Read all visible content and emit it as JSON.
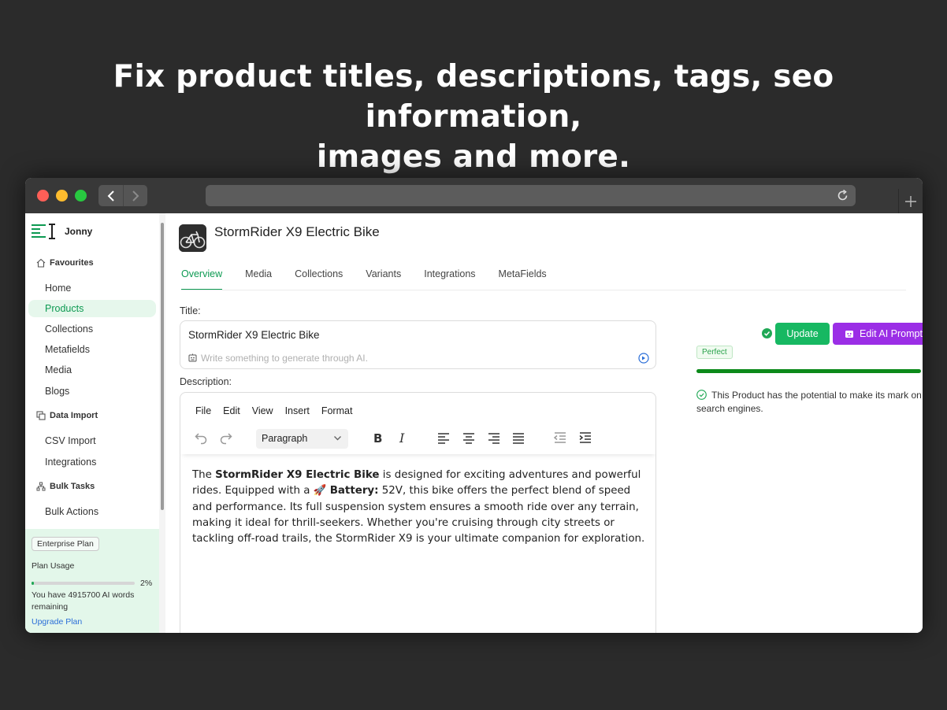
{
  "headline": {
    "line1": "Fix product titles, descriptions, tags, seo information,",
    "line2": "images and more."
  },
  "browser": {
    "url": ""
  },
  "sidebar": {
    "brand": "Jonny",
    "sections": {
      "favourites": "Favourites",
      "data_import": "Data Import",
      "bulk_tasks": "Bulk Tasks"
    },
    "items": [
      {
        "label": "Home"
      },
      {
        "label": "Products",
        "active": true
      },
      {
        "label": "Collections"
      },
      {
        "label": "Metafields"
      },
      {
        "label": "Media"
      },
      {
        "label": "Blogs"
      },
      {
        "label": "CSV Import"
      },
      {
        "label": "Integrations"
      },
      {
        "label": "Bulk Actions"
      }
    ],
    "plan": {
      "badge": "Enterprise Plan",
      "usage_label": "Plan Usage",
      "usage_percent": "2%",
      "usage_fraction": 0.02,
      "words_remaining": "You have 4915700 AI words remaining",
      "upgrade": "Upgrade Plan"
    }
  },
  "product": {
    "title": "StormRider X9 Electric Bike",
    "tabs": [
      "Overview",
      "Media",
      "Collections",
      "Variants",
      "Integrations",
      "MetaFields"
    ],
    "active_tab": "Overview"
  },
  "form": {
    "title_label": "Title:",
    "title_value": "StormRider X9 Electric Bike",
    "ai_placeholder": "Write something to generate through AI.",
    "description_label": "Description:"
  },
  "editor": {
    "menu": [
      "File",
      "Edit",
      "View",
      "Insert",
      "Format"
    ],
    "block_format": "Paragraph",
    "content": {
      "p1": "The ",
      "b1": "StormRider X9 Electric Bike",
      "p2": " is designed for exciting adventures and powerful rides. Equipped with a 🚀 ",
      "b2": "Battery:",
      "p3": " 52V, this bike offers the perfect blend of speed and performance. Its full suspension system ensures a smooth ride over any terrain, making it ideal for thrill-seekers. Whether you're cruising through city streets or tackling off-road trails, the StormRider X9 is your ultimate companion for exploration."
    }
  },
  "actions": {
    "update": "Update",
    "edit_ai_prompt": "Edit AI Prompt"
  },
  "seo": {
    "badge": "Perfect",
    "score_fraction": 1.0,
    "message": "This Product has the potential to make its mark on search engines."
  },
  "colors": {
    "accent_green": "#0d9a52",
    "update_button": "#17b862",
    "ai_button": "#9b2ee6",
    "chat_bubble": "#1fe07a"
  }
}
